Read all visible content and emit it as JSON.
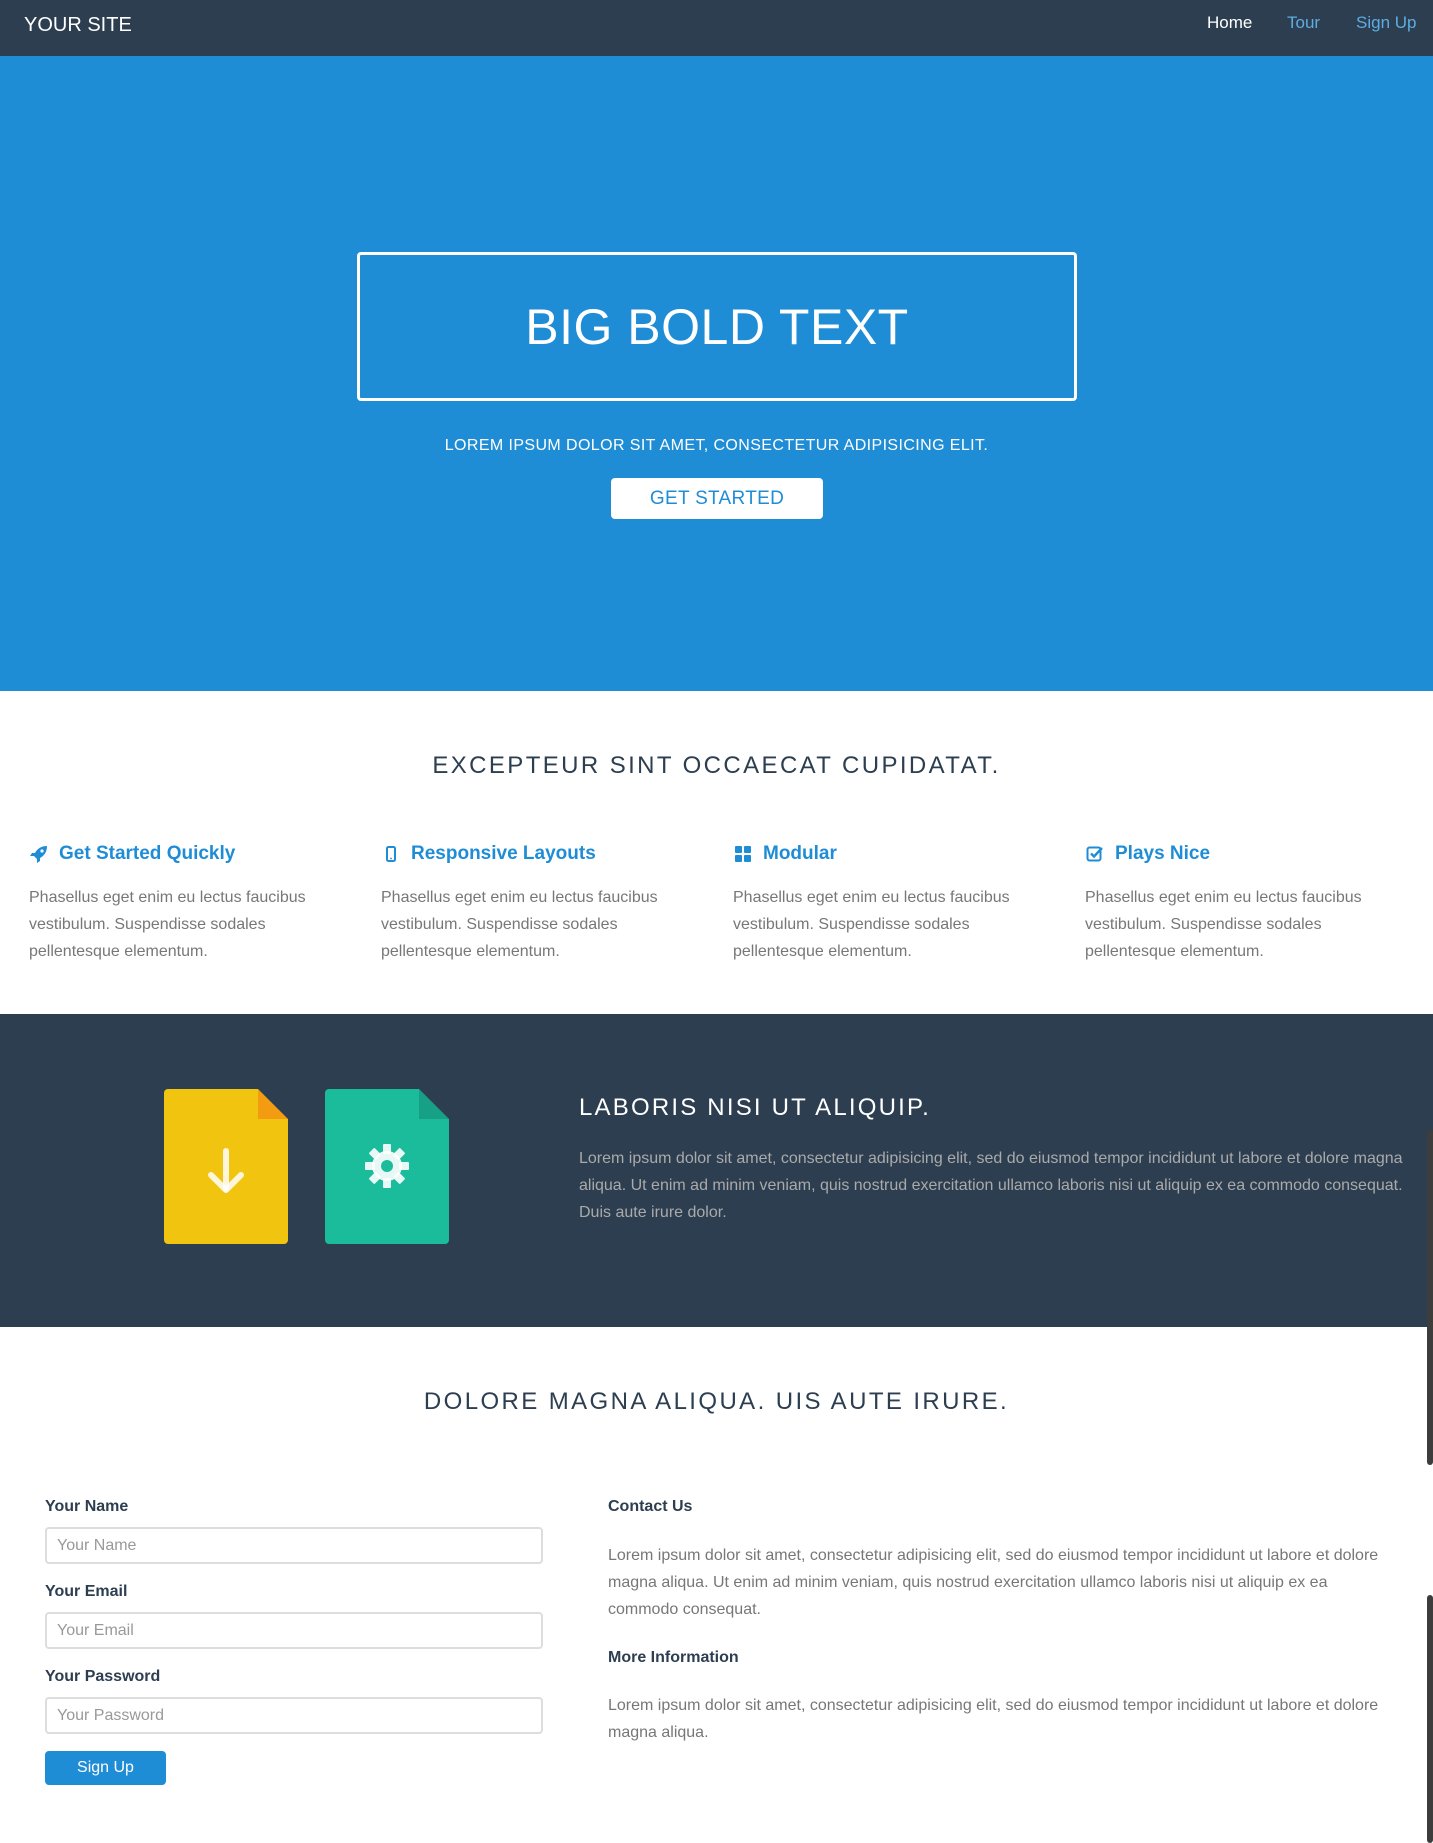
{
  "nav": {
    "brand": "YOUR SITE",
    "links": [
      "Home",
      "Tour",
      "Sign Up"
    ]
  },
  "hero": {
    "title": "BIG BOLD TEXT",
    "subtitle": "LOREM IPSUM DOLOR SIT AMET, CONSECTETUR ADIPISICING ELIT.",
    "button": "GET STARTED"
  },
  "features": {
    "heading": "EXCEPTEUR SINT OCCAECAT CUPIDATAT.",
    "items": [
      {
        "icon": "rocket-icon",
        "title": "Get Started Quickly",
        "text": "Phasellus eget enim eu lectus faucibus vestibulum. Suspendisse sodales pellentesque elementum."
      },
      {
        "icon": "mobile-icon",
        "title": "Responsive Layouts",
        "text": "Phasellus eget enim eu lectus faucibus vestibulum. Suspendisse sodales pellentesque elementum."
      },
      {
        "icon": "grid-icon",
        "title": "Modular",
        "text": "Phasellus eget enim eu lectus faucibus vestibulum. Suspendisse sodales pellentesque elementum."
      },
      {
        "icon": "check-square-icon",
        "title": "Plays Nice",
        "text": "Phasellus eget enim eu lectus faucibus vestibulum. Suspendisse sodales pellentesque elementum."
      }
    ]
  },
  "promo": {
    "heading": "LABORIS NISI UT ALIQUIP.",
    "text": "Lorem ipsum dolor sit amet, consectetur adipisicing elit, sed do eiusmod tempor incididunt ut labore et dolore magna aliqua. Ut enim ad minim veniam, quis nostrud exercitation ullamco laboris nisi ut aliquip ex ea commodo consequat. Duis aute irure dolor.",
    "icons": [
      "download-file-icon",
      "settings-file-icon"
    ]
  },
  "contact": {
    "heading": "DOLORE MAGNA ALIQUA. UIS AUTE IRURE.",
    "form": {
      "name_label": "Your Name",
      "name_placeholder": "Your Name",
      "email_label": "Your Email",
      "email_placeholder": "Your Email",
      "password_label": "Your Password",
      "password_placeholder": "Your Password",
      "submit": "Sign Up"
    },
    "info": {
      "contact_heading": "Contact Us",
      "contact_text": "Lorem ipsum dolor sit amet, consectetur adipisicing elit, sed do eiusmod tempor incididunt ut labore et dolore magna aliqua. Ut enim ad minim veniam, quis nostrud exercitation ullamco laboris nisi ut aliquip ex ea commodo consequat.",
      "more_heading": "More Information",
      "more_text": "Lorem ipsum dolor sit amet, consectetur adipisicing elit, sed do eiusmod tempor incididunt ut labore et dolore magna aliqua."
    }
  },
  "colors": {
    "navbar": "#2c3e50",
    "accent": "#1f8dd6",
    "yellow_file": "#f1c40f",
    "green_file": "#1abc9c"
  }
}
